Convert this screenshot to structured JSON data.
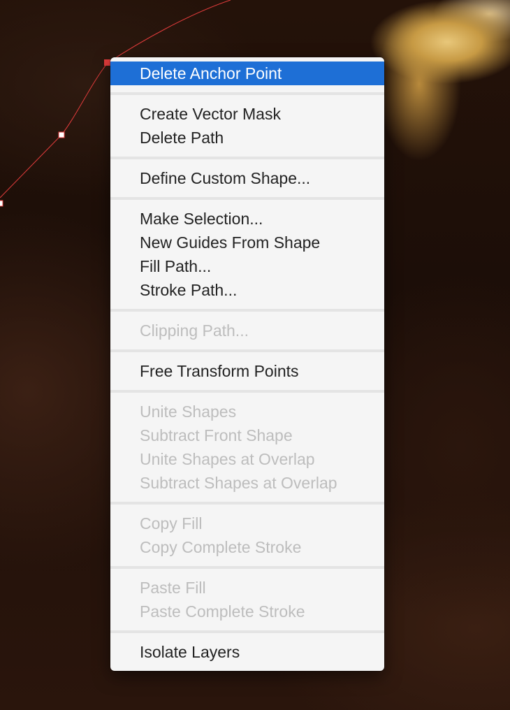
{
  "menu": {
    "groups": [
      {
        "items": [
          {
            "label": "Delete Anchor Point",
            "state": "highlighted"
          }
        ]
      },
      {
        "items": [
          {
            "label": "Create Vector Mask",
            "state": "enabled"
          },
          {
            "label": "Delete Path",
            "state": "enabled"
          }
        ]
      },
      {
        "items": [
          {
            "label": "Define Custom Shape...",
            "state": "enabled"
          }
        ]
      },
      {
        "items": [
          {
            "label": "Make Selection...",
            "state": "enabled"
          },
          {
            "label": "New Guides From Shape",
            "state": "enabled"
          },
          {
            "label": "Fill Path...",
            "state": "enabled"
          },
          {
            "label": "Stroke Path...",
            "state": "enabled"
          }
        ]
      },
      {
        "items": [
          {
            "label": "Clipping Path...",
            "state": "disabled"
          }
        ]
      },
      {
        "items": [
          {
            "label": "Free Transform Points",
            "state": "enabled"
          }
        ]
      },
      {
        "items": [
          {
            "label": "Unite Shapes",
            "state": "disabled"
          },
          {
            "label": "Subtract Front Shape",
            "state": "disabled"
          },
          {
            "label": "Unite Shapes at Overlap",
            "state": "disabled"
          },
          {
            "label": "Subtract Shapes at Overlap",
            "state": "disabled"
          }
        ]
      },
      {
        "items": [
          {
            "label": "Copy Fill",
            "state": "disabled"
          },
          {
            "label": "Copy Complete Stroke",
            "state": "disabled"
          }
        ]
      },
      {
        "items": [
          {
            "label": "Paste Fill",
            "state": "disabled"
          },
          {
            "label": "Paste Complete Stroke",
            "state": "disabled"
          }
        ]
      },
      {
        "items": [
          {
            "label": "Isolate Layers",
            "state": "enabled"
          }
        ]
      }
    ]
  },
  "colors": {
    "highlight": "#1e6fd6",
    "path_stroke": "#e23c3c",
    "disabled_text": "#bdbdbd"
  }
}
